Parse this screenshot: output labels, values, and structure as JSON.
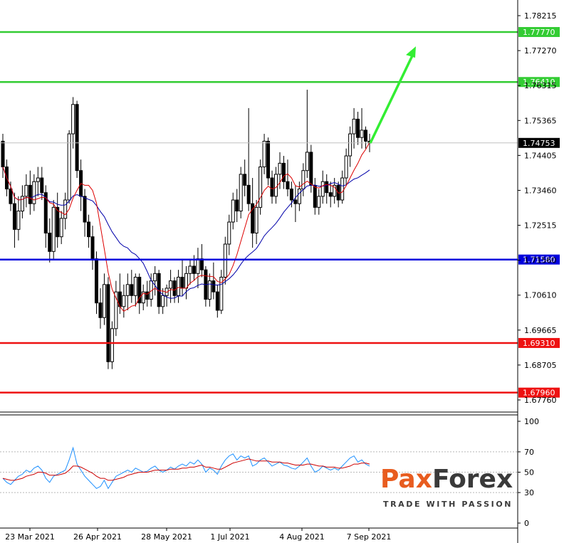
{
  "chart_data": [
    {
      "type": "candlestick",
      "xlabels": [
        "23 Mar 2021",
        "26 Apr 2021",
        "28 May 2021",
        "1 Jul 2021",
        "4 Aug 2021",
        "7 Sep 2021"
      ],
      "ylim": [
        1.6729,
        1.7858
      ],
      "yticks": [
        "1.78215",
        "1.77270",
        "1.76315",
        "1.75365",
        "1.74405",
        "1.73460",
        "1.72515",
        "1.71560",
        "1.70610",
        "1.69665",
        "1.68705",
        "1.67760"
      ],
      "current_price": "1.74753",
      "horizontal_levels": [
        {
          "label": "1.77770",
          "value": 1.7777,
          "color": "#33cc33"
        },
        {
          "label": "1.76410",
          "value": 1.7641,
          "color": "#33cc33"
        },
        {
          "label": "1.71580",
          "value": 1.7158,
          "color": "#0000dd"
        },
        {
          "label": "1.69310",
          "value": 1.6931,
          "color": "#ee1111"
        },
        {
          "label": "1.67960",
          "value": 1.6796,
          "color": "#ee1111"
        }
      ],
      "forecast_arrow": {
        "from": 1.7475,
        "to": 1.7738,
        "color": "#33ee33"
      },
      "ma_fast_color": "#dd0000",
      "ma_slow_color": "#0000aa",
      "candle_color": "#000000",
      "candles": [
        [
          1.748,
          1.75,
          1.738,
          1.741
        ],
        [
          1.741,
          1.743,
          1.733,
          1.735
        ],
        [
          1.735,
          1.737,
          1.729,
          1.731
        ],
        [
          1.731,
          1.734,
          1.719,
          1.724
        ],
        [
          1.724,
          1.733,
          1.721,
          1.729
        ],
        [
          1.729,
          1.736,
          1.727,
          1.733
        ],
        [
          1.733,
          1.739,
          1.73,
          1.736
        ],
        [
          1.736,
          1.74,
          1.728,
          1.731
        ],
        [
          1.731,
          1.739,
          1.729,
          1.737
        ],
        [
          1.737,
          1.741,
          1.733,
          1.738
        ],
        [
          1.738,
          1.741,
          1.732,
          1.734
        ],
        [
          1.734,
          1.736,
          1.719,
          1.723
        ],
        [
          1.723,
          1.727,
          1.715,
          1.718
        ],
        [
          1.718,
          1.732,
          1.716,
          1.73
        ],
        [
          1.73,
          1.734,
          1.719,
          1.722
        ],
        [
          1.722,
          1.729,
          1.72,
          1.727
        ],
        [
          1.727,
          1.734,
          1.724,
          1.732
        ],
        [
          1.732,
          1.751,
          1.731,
          1.75
        ],
        [
          1.75,
          1.76,
          1.746,
          1.758
        ],
        [
          1.758,
          1.759,
          1.738,
          1.74
        ],
        [
          1.74,
          1.743,
          1.729,
          1.733
        ],
        [
          1.733,
          1.735,
          1.722,
          1.726
        ],
        [
          1.726,
          1.728,
          1.719,
          1.722
        ],
        [
          1.722,
          1.725,
          1.713,
          1.716
        ],
        [
          1.716,
          1.718,
          1.701,
          1.704
        ],
        [
          1.704,
          1.708,
          1.697,
          1.7
        ],
        [
          1.7,
          1.712,
          1.698,
          1.709
        ],
        [
          1.709,
          1.711,
          1.686,
          1.688
        ],
        [
          1.688,
          1.699,
          1.686,
          1.697
        ],
        [
          1.697,
          1.71,
          1.695,
          1.707
        ],
        [
          1.707,
          1.712,
          1.701,
          1.703
        ],
        [
          1.703,
          1.709,
          1.7,
          1.706
        ],
        [
          1.706,
          1.712,
          1.702,
          1.709
        ],
        [
          1.709,
          1.713,
          1.704,
          1.706
        ],
        [
          1.706,
          1.712,
          1.703,
          1.711
        ],
        [
          1.711,
          1.712,
          1.701,
          1.704
        ],
        [
          1.704,
          1.709,
          1.702,
          1.707
        ],
        [
          1.707,
          1.71,
          1.703,
          1.705
        ],
        [
          1.705,
          1.712,
          1.703,
          1.71
        ],
        [
          1.71,
          1.714,
          1.706,
          1.712
        ],
        [
          1.712,
          1.713,
          1.701,
          1.703
        ],
        [
          1.703,
          1.708,
          1.701,
          1.706
        ],
        [
          1.706,
          1.709,
          1.703,
          1.708
        ],
        [
          1.708,
          1.713,
          1.704,
          1.71
        ],
        [
          1.71,
          1.711,
          1.704,
          1.706
        ],
        [
          1.706,
          1.713,
          1.704,
          1.711
        ],
        [
          1.711,
          1.716,
          1.706,
          1.708
        ],
        [
          1.708,
          1.714,
          1.705,
          1.712
        ],
        [
          1.712,
          1.716,
          1.709,
          1.714
        ],
        [
          1.714,
          1.717,
          1.71,
          1.712
        ],
        [
          1.712,
          1.719,
          1.708,
          1.716
        ],
        [
          1.716,
          1.72,
          1.711,
          1.713
        ],
        [
          1.713,
          1.714,
          1.703,
          1.705
        ],
        [
          1.705,
          1.712,
          1.703,
          1.71
        ],
        [
          1.71,
          1.715,
          1.705,
          1.707
        ],
        [
          1.707,
          1.709,
          1.7,
          1.702
        ],
        [
          1.702,
          1.713,
          1.701,
          1.711
        ],
        [
          1.711,
          1.722,
          1.709,
          1.72
        ],
        [
          1.72,
          1.728,
          1.717,
          1.726
        ],
        [
          1.726,
          1.734,
          1.724,
          1.732
        ],
        [
          1.732,
          1.735,
          1.726,
          1.729
        ],
        [
          1.729,
          1.741,
          1.727,
          1.739
        ],
        [
          1.739,
          1.743,
          1.733,
          1.736
        ],
        [
          1.736,
          1.757,
          1.729,
          1.731
        ],
        [
          1.731,
          1.738,
          1.719,
          1.723
        ],
        [
          1.723,
          1.732,
          1.72,
          1.73
        ],
        [
          1.73,
          1.743,
          1.728,
          1.741
        ],
        [
          1.741,
          1.75,
          1.739,
          1.748
        ],
        [
          1.748,
          1.749,
          1.736,
          1.738
        ],
        [
          1.738,
          1.74,
          1.731,
          1.733
        ],
        [
          1.733,
          1.741,
          1.731,
          1.739
        ],
        [
          1.739,
          1.745,
          1.735,
          1.742
        ],
        [
          1.742,
          1.744,
          1.735,
          1.737
        ],
        [
          1.737,
          1.743,
          1.733,
          1.735
        ],
        [
          1.735,
          1.737,
          1.73,
          1.732
        ],
        [
          1.732,
          1.736,
          1.726,
          1.731
        ],
        [
          1.731,
          1.737,
          1.729,
          1.735
        ],
        [
          1.735,
          1.742,
          1.733,
          1.74
        ],
        [
          1.74,
          1.762,
          1.738,
          1.745
        ],
        [
          1.745,
          1.747,
          1.734,
          1.736
        ],
        [
          1.736,
          1.738,
          1.728,
          1.73
        ],
        [
          1.73,
          1.735,
          1.728,
          1.733
        ],
        [
          1.733,
          1.74,
          1.731,
          1.737
        ],
        [
          1.737,
          1.739,
          1.731,
          1.734
        ],
        [
          1.734,
          1.737,
          1.73,
          1.733
        ],
        [
          1.733,
          1.738,
          1.731,
          1.736
        ],
        [
          1.736,
          1.737,
          1.73,
          1.732
        ],
        [
          1.732,
          1.74,
          1.731,
          1.738
        ],
        [
          1.738,
          1.746,
          1.736,
          1.744
        ],
        [
          1.744,
          1.752,
          1.741,
          1.75
        ],
        [
          1.75,
          1.757,
          1.746,
          1.754
        ],
        [
          1.754,
          1.756,
          1.747,
          1.749
        ],
        [
          1.749,
          1.757,
          1.746,
          1.751
        ],
        [
          1.751,
          1.752,
          1.746,
          1.748
        ],
        [
          1.748,
          1.75,
          1.745,
          1.7475
        ]
      ]
    },
    {
      "type": "line",
      "indicator": "oscillator",
      "ylim": [
        0,
        100
      ],
      "yticks": [
        "100",
        "70",
        "50",
        "30",
        "0"
      ],
      "levels": [
        70,
        50,
        30
      ],
      "line_color": "#1e90ff",
      "signal_color": "#cc0000",
      "values": [
        44,
        40,
        38,
        42,
        46,
        48,
        52,
        50,
        54,
        56,
        52,
        44,
        40,
        46,
        48,
        50,
        52,
        62,
        74,
        58,
        52,
        46,
        42,
        38,
        34,
        36,
        42,
        34,
        40,
        46,
        48,
        50,
        52,
        50,
        54,
        52,
        50,
        51,
        54,
        56,
        52,
        50,
        52,
        55,
        53,
        56,
        58,
        56,
        60,
        58,
        62,
        58,
        50,
        54,
        52,
        48,
        56,
        62,
        66,
        68,
        62,
        66,
        64,
        66,
        56,
        58,
        62,
        64,
        60,
        56,
        58,
        60,
        57,
        56,
        54,
        53,
        56,
        60,
        64,
        56,
        50,
        52,
        56,
        54,
        52,
        54,
        52,
        56,
        60,
        64,
        66,
        60,
        62,
        58,
        56
      ],
      "signal": [
        44,
        43,
        42,
        42,
        43,
        44,
        46,
        47,
        48,
        50,
        50,
        49,
        47,
        47,
        47,
        48,
        49,
        52,
        56,
        56,
        55,
        53,
        51,
        49,
        46,
        44,
        44,
        42,
        42,
        43,
        44,
        45,
        47,
        48,
        49,
        50,
        50,
        50,
        51,
        52,
        52,
        52,
        52,
        53,
        53,
        53,
        54,
        54,
        55,
        55,
        56,
        57,
        55,
        55,
        54,
        53,
        53,
        55,
        57,
        59,
        60,
        61,
        62,
        63,
        62,
        61,
        61,
        61,
        61,
        60,
        60,
        60,
        59,
        59,
        58,
        57,
        57,
        57,
        58,
        58,
        57,
        56,
        56,
        55,
        55,
        55,
        54,
        54,
        55,
        56,
        58,
        58,
        59,
        59,
        58
      ]
    }
  ],
  "logo": {
    "word_part1": "Pax",
    "word_part2": "Forex",
    "tagline": "TRADE WITH PASSION"
  }
}
